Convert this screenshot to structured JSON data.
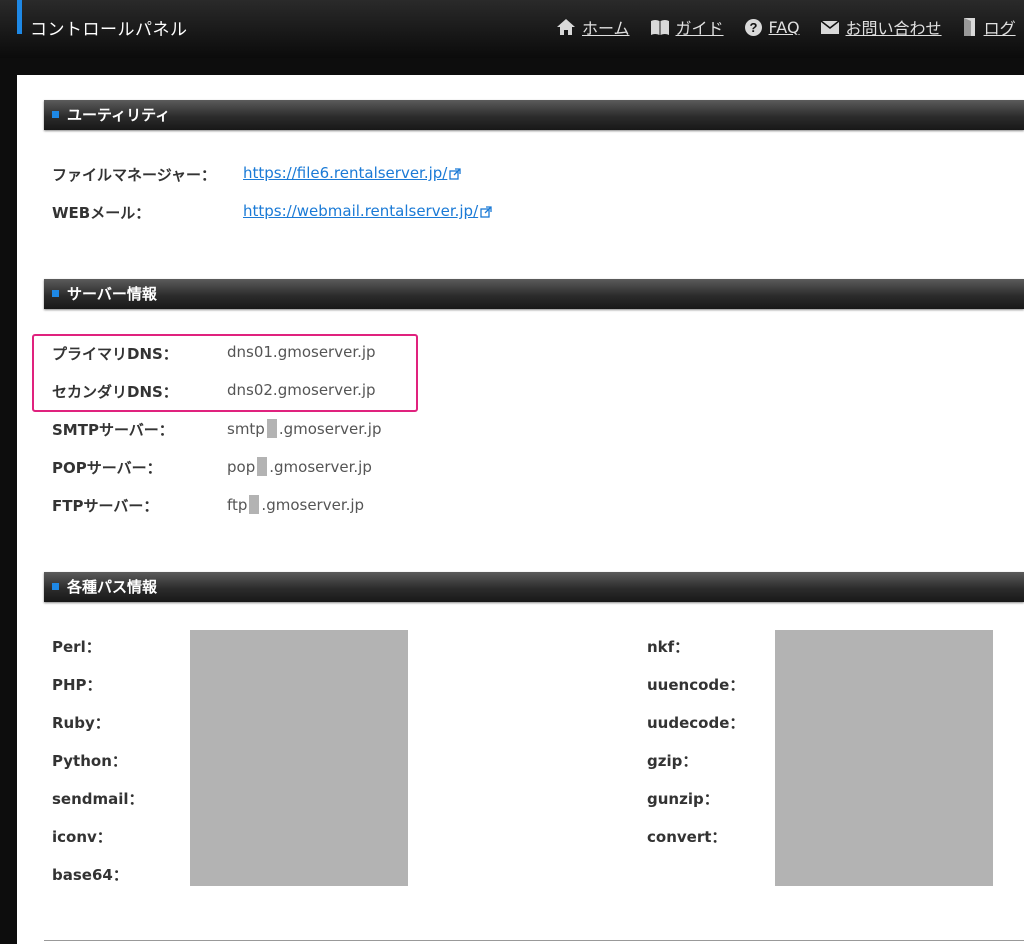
{
  "header": {
    "title": "コントロールパネル",
    "nav": [
      {
        "label": "ホーム",
        "icon": "home-icon"
      },
      {
        "label": "ガイド",
        "icon": "book-icon"
      },
      {
        "label": "FAQ",
        "icon": "question-icon"
      },
      {
        "label": "お問い合わせ",
        "icon": "mail-icon"
      },
      {
        "label": "ログ",
        "icon": "door-icon"
      }
    ]
  },
  "utility": {
    "title": "ユーティリティ",
    "rows": [
      {
        "label": "ファイルマネージャー：",
        "url": "https://file6.rentalserver.jp/"
      },
      {
        "label": "WEBメール：",
        "url": "https://webmail.rentalserver.jp/"
      }
    ]
  },
  "server_info": {
    "title": "サーバー情報",
    "rows": [
      {
        "label": "プライマリDNS：",
        "prefix": "dns01.gmoserver.jp",
        "suffix": ""
      },
      {
        "label": "セカンダリDNS：",
        "prefix": "dns02.gmoserver.jp",
        "suffix": ""
      },
      {
        "label": "SMTPサーバー：",
        "prefix": "smtp",
        "suffix": ".gmoserver.jp"
      },
      {
        "label": "POPサーバー：",
        "prefix": "pop",
        "suffix": ".gmoserver.jp"
      },
      {
        "label": "FTPサーバー：",
        "prefix": "ftp",
        "suffix": ".gmoserver.jp"
      }
    ]
  },
  "paths": {
    "title": "各種パス情報",
    "left_labels": [
      "Perl：",
      "PHP：",
      "Ruby：",
      "Python：",
      "sendmail：",
      "iconv：",
      "base64："
    ],
    "right_labels": [
      "nkf：",
      "uuencode：",
      "uudecode：",
      "gzip：",
      "gunzip：",
      "convert："
    ]
  },
  "colors": {
    "accent": "#1e88e5",
    "highlight": "#e0227e",
    "link": "#1a7ad6",
    "mask": "#b3b3b3"
  }
}
